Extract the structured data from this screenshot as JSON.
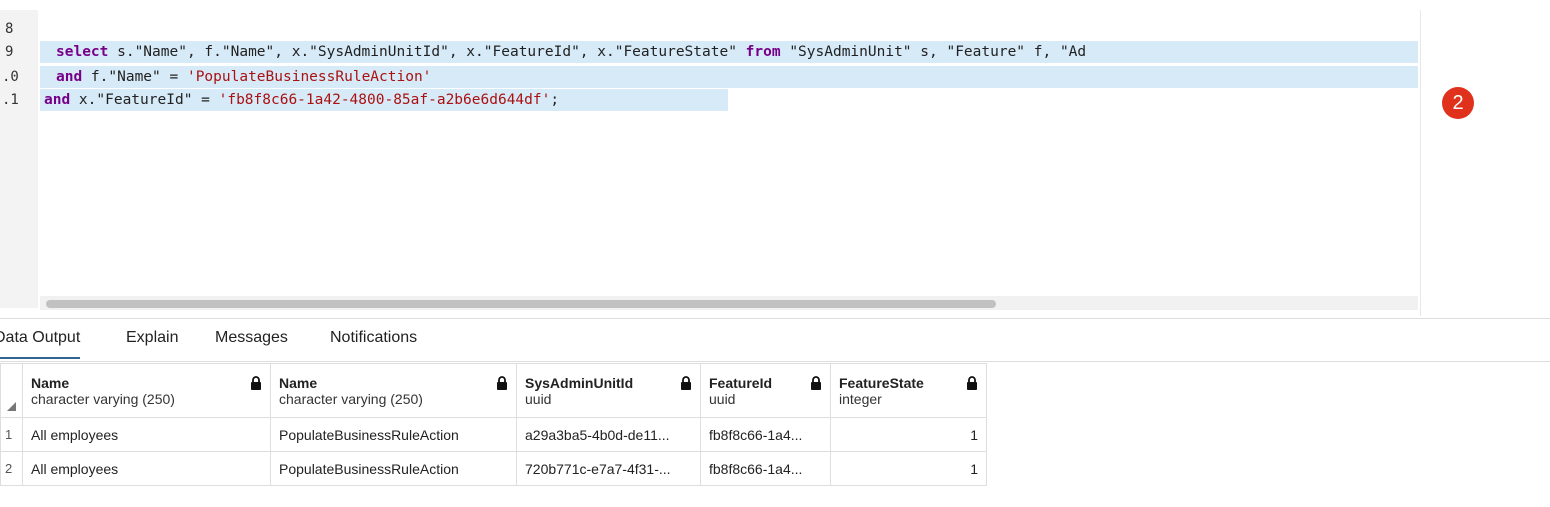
{
  "editor": {
    "line_numbers": [
      "8",
      "9",
      ".0",
      ".1"
    ],
    "line9": {
      "k1": "select",
      "t1": " s.\"Name\", f.\"Name\", x.\"SysAdminUnitId\", x.\"FeatureId\", x.\"FeatureState\" ",
      "k2": "from",
      "t2": " \"SysAdminUnit\" s, \"Feature\" f, \"Ad"
    },
    "line10": {
      "k1": "and",
      "t1": " f.\"Name\" = ",
      "s1": "'PopulateBusinessRuleAction'"
    },
    "line11": {
      "k1": "and",
      "t1": " x.\"FeatureId\" = ",
      "s1": "'fb8f8c66-1a42-4800-85af-a2b6e6d644df'",
      "t2": ";"
    }
  },
  "badge": {
    "value": "2"
  },
  "tabs": [
    {
      "label": "Data Output"
    },
    {
      "label": "Explain"
    },
    {
      "label": "Messages"
    },
    {
      "label": "Notifications"
    }
  ],
  "grid": {
    "columns": [
      {
        "name": "Name",
        "type": "character varying (250)"
      },
      {
        "name": "Name",
        "type": "character varying (250)"
      },
      {
        "name": "SysAdminUnitId",
        "type": "uuid"
      },
      {
        "name": "FeatureId",
        "type": "uuid"
      },
      {
        "name": "FeatureState",
        "type": "integer"
      }
    ],
    "rows": [
      {
        "num": "1",
        "cells": [
          "All employees",
          "PopulateBusinessRuleAction",
          "a29a3ba5-4b0d-de11...",
          "fb8f8c66-1a4...",
          "1"
        ]
      },
      {
        "num": "2",
        "cells": [
          "All employees",
          "PopulateBusinessRuleAction",
          "720b771c-e7a7-4f31-...",
          "fb8f8c66-1a4...",
          "1"
        ]
      }
    ]
  },
  "colors": {
    "accent": "#326690",
    "selection": "#d6eaf8",
    "keyword": "#770088",
    "string": "#aa1111",
    "badge": "#e0311c"
  }
}
